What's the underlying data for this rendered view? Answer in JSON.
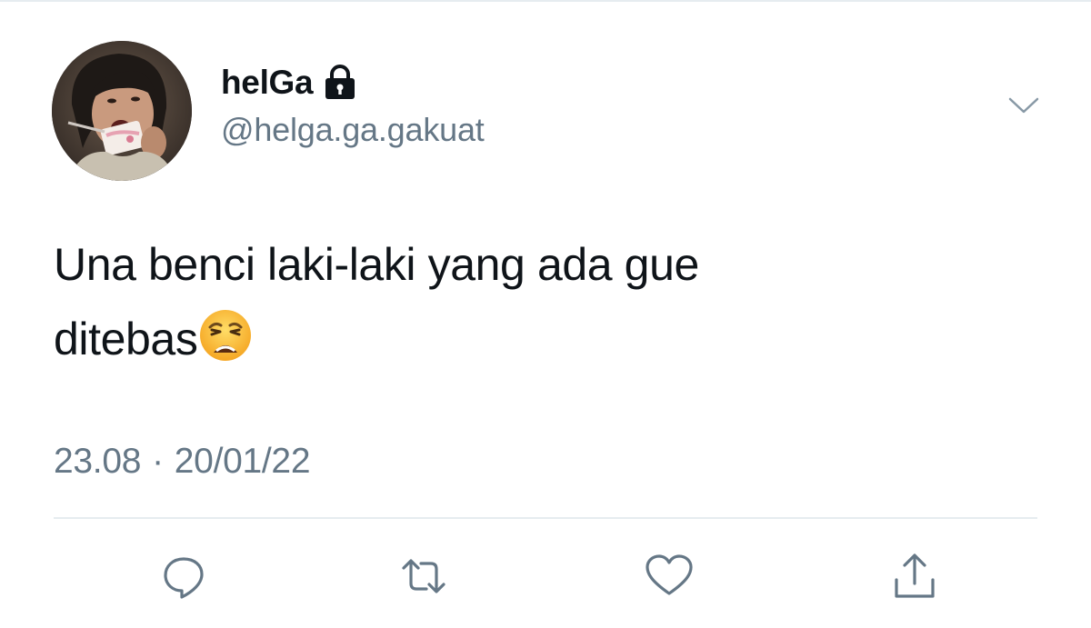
{
  "tweet": {
    "display_name": "helGa",
    "protected_icon": "lock-icon",
    "handle": "@helga.ga.gakuat",
    "text_line1": "Una benci laki-laki yang ada gue",
    "text_line2": "ditebas",
    "emoji": "weary-face-emoji",
    "time": "23.08",
    "separator": "·",
    "date": "20/01/22"
  },
  "actions": [
    {
      "icon": "reply-icon"
    },
    {
      "icon": "retweet-icon"
    },
    {
      "icon": "like-icon"
    },
    {
      "icon": "share-icon"
    }
  ],
  "colors": {
    "text_primary": "#0f1419",
    "text_secondary": "#657786",
    "divider": "#e6ecf0",
    "icon": "#657786"
  }
}
